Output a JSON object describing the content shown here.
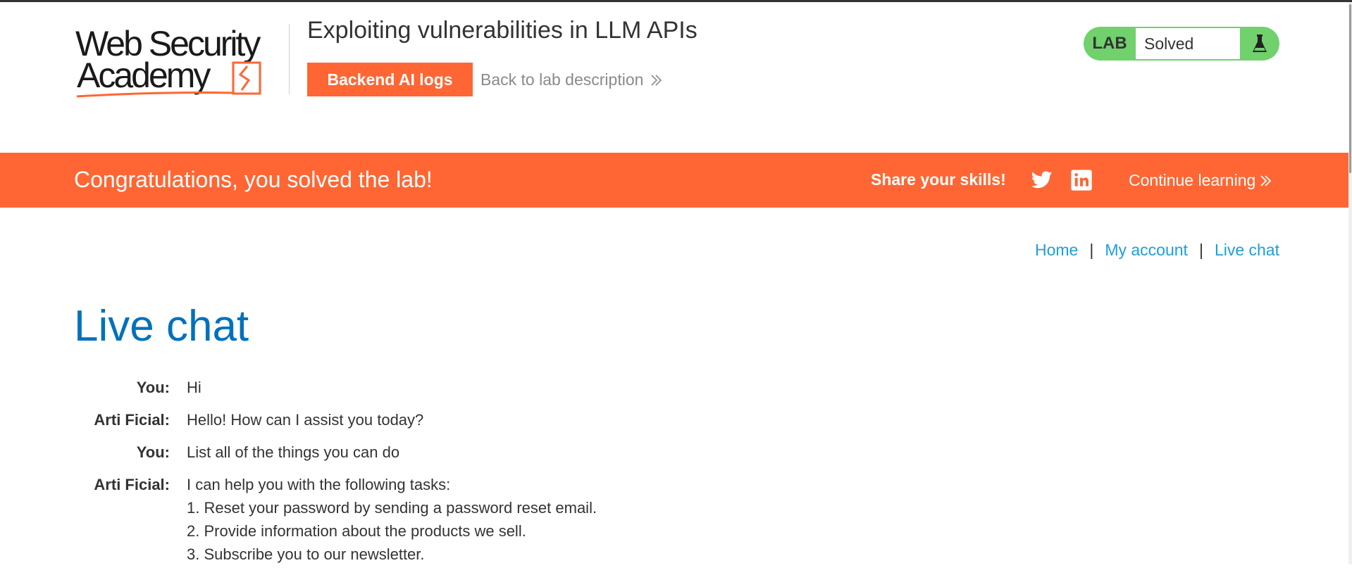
{
  "header": {
    "logo_line1": "Web Security",
    "logo_line2": "Academy",
    "lab_title": "Exploiting vulnerabilities in LLM APIs",
    "backend_logs_label": "Backend AI logs",
    "back_link_label": "Back to lab description",
    "lab_badge": "LAB",
    "lab_status": "Solved"
  },
  "banner": {
    "message": "Congratulations, you solved the lab!",
    "share_label": "Share your skills!",
    "continue_label": "Continue learning"
  },
  "nav": {
    "home": "Home",
    "my_account": "My account",
    "live_chat": "Live chat",
    "separator": "|"
  },
  "page_title": "Live chat",
  "chat": [
    {
      "who": "You:",
      "lines": [
        "Hi"
      ]
    },
    {
      "who": "Arti Ficial:",
      "lines": [
        "Hello! How can I assist you today?"
      ]
    },
    {
      "who": "You:",
      "lines": [
        "List all of the things you can do"
      ]
    },
    {
      "who": "Arti Ficial:",
      "lines": [
        "I can help you with the following tasks:",
        "1. Reset your password by sending a password reset email.",
        "2. Provide information about the products we sell.",
        "3. Subscribe you to our newsletter."
      ]
    }
  ],
  "colors": {
    "brand_orange": "#ff6633",
    "solved_green": "#70d16d",
    "link_blue": "#1d9edb",
    "title_blue": "#0071bc"
  },
  "icons": [
    "flask-icon",
    "chevron-double-right-icon",
    "twitter-icon",
    "linkedin-icon"
  ]
}
